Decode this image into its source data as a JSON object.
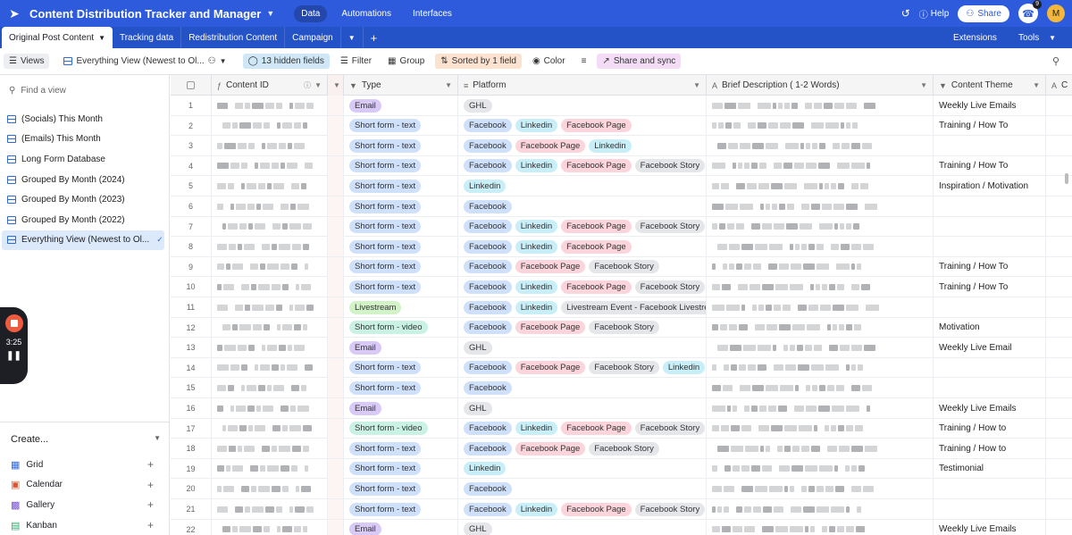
{
  "app": {
    "title": "Content Distribution Tracker and Manager",
    "nav": [
      "Data",
      "Automations",
      "Interfaces"
    ],
    "active_nav": "Data",
    "help": "Help",
    "share": "Share",
    "notif_count": "9",
    "avatar": "M"
  },
  "tabs": {
    "items": [
      "Original Post Content",
      "Tracking data",
      "Redistribution Content",
      "Campaign"
    ],
    "extensions": "Extensions",
    "tools": "Tools"
  },
  "viewbar": {
    "views": "Views",
    "current_view": "Everything View (Newest to Ol...",
    "hidden": "13 hidden fields",
    "filter": "Filter",
    "group": "Group",
    "sorted": "Sorted by 1 field",
    "color": "Color",
    "share_sync": "Share and sync"
  },
  "sidebar": {
    "find_placeholder": "Find a view",
    "views": [
      "(Socials) This Month",
      "(Emails) This Month",
      "Long Form Database",
      "Grouped By Month (2024)",
      "Grouped By Month (2023)",
      "Grouped By Month (2022)",
      "Everything View (Newest to Ol..."
    ],
    "create_label": "Create...",
    "create_items": [
      "Grid",
      "Calendar",
      "Gallery",
      "Kanban"
    ]
  },
  "recorder": {
    "time": "3:25"
  },
  "columns": [
    "Content ID",
    "Type",
    "Platform",
    "Brief Description ( 1-2 Words)",
    "Content Theme",
    "C"
  ],
  "tag_colors": {
    "Email": "#d9c9f6",
    "Short form - text": "#cfe0fb",
    "Short form - video": "#c9f1e4",
    "Livestream": "#d2f2c8",
    "GHL": "#e4e6ea",
    "Facebook": "#cfe0fb",
    "Linkedin": "#c8eef8",
    "Facebook Page": "#fbd4dc",
    "Facebook Story": "#e4e6ea",
    "Livestream Event - Facebook Livestream": "#e4e6ea"
  },
  "rows": [
    {
      "n": "1",
      "type": "Email",
      "platforms": [
        "GHL"
      ],
      "theme": "Weekly Live Emails"
    },
    {
      "n": "2",
      "type": "Short form - text",
      "platforms": [
        "Facebook",
        "Linkedin",
        "Facebook Page"
      ],
      "theme": "Training / How To"
    },
    {
      "n": "3",
      "type": "Short form - text",
      "platforms": [
        "Facebook",
        "Facebook Page",
        "Linkedin"
      ],
      "theme": ""
    },
    {
      "n": "4",
      "type": "Short form - text",
      "platforms": [
        "Facebook",
        "Linkedin",
        "Facebook Page",
        "Facebook Story"
      ],
      "theme": "Training / How To"
    },
    {
      "n": "5",
      "type": "Short form - text",
      "platforms": [
        "Linkedin"
      ],
      "theme": "Inspiration / Motivation"
    },
    {
      "n": "6",
      "type": "Short form - text",
      "platforms": [
        "Facebook"
      ],
      "theme": ""
    },
    {
      "n": "7",
      "type": "Short form - text",
      "platforms": [
        "Facebook",
        "Linkedin",
        "Facebook Page",
        "Facebook Story"
      ],
      "theme": ""
    },
    {
      "n": "8",
      "type": "Short form - text",
      "platforms": [
        "Facebook",
        "Linkedin",
        "Facebook Page"
      ],
      "theme": ""
    },
    {
      "n": "9",
      "type": "Short form - text",
      "platforms": [
        "Facebook",
        "Facebook Page",
        "Facebook Story"
      ],
      "theme": "Training / How To"
    },
    {
      "n": "10",
      "type": "Short form - text",
      "platforms": [
        "Facebook",
        "Linkedin",
        "Facebook Page",
        "Facebook Story"
      ],
      "theme": "Training / How To"
    },
    {
      "n": "11",
      "type": "Livestream",
      "platforms": [
        "Facebook",
        "Linkedin",
        "Livestream Event - Facebook Livestream"
      ],
      "theme": ""
    },
    {
      "n": "12",
      "type": "Short form - video",
      "platforms": [
        "Facebook",
        "Facebook Page",
        "Facebook Story"
      ],
      "theme": "Motivation"
    },
    {
      "n": "13",
      "type": "Email",
      "platforms": [
        "GHL"
      ],
      "theme": "Weekly Live Email"
    },
    {
      "n": "14",
      "type": "Short form - text",
      "platforms": [
        "Facebook",
        "Facebook Page",
        "Facebook Story",
        "Linkedin"
      ],
      "theme": ""
    },
    {
      "n": "15",
      "type": "Short form - text",
      "platforms": [
        "Facebook"
      ],
      "theme": ""
    },
    {
      "n": "16",
      "type": "Email",
      "platforms": [
        "GHL"
      ],
      "theme": "Weekly Live Emails"
    },
    {
      "n": "17",
      "type": "Short form - video",
      "platforms": [
        "Facebook",
        "Linkedin",
        "Facebook Page",
        "Facebook Story"
      ],
      "theme": "Training / How to"
    },
    {
      "n": "18",
      "type": "Short form - text",
      "platforms": [
        "Facebook",
        "Facebook Page",
        "Facebook Story"
      ],
      "theme": "Training / How to"
    },
    {
      "n": "19",
      "type": "Short form - text",
      "platforms": [
        "Linkedin"
      ],
      "theme": "Testimonial"
    },
    {
      "n": "20",
      "type": "Short form - text",
      "platforms": [
        "Facebook"
      ],
      "theme": ""
    },
    {
      "n": "21",
      "type": "Short form - text",
      "platforms": [
        "Facebook",
        "Linkedin",
        "Facebook Page",
        "Facebook Story"
      ],
      "theme": ""
    },
    {
      "n": "22",
      "type": "Email",
      "platforms": [
        "GHL"
      ],
      "theme": "Weekly Live Emails"
    }
  ]
}
